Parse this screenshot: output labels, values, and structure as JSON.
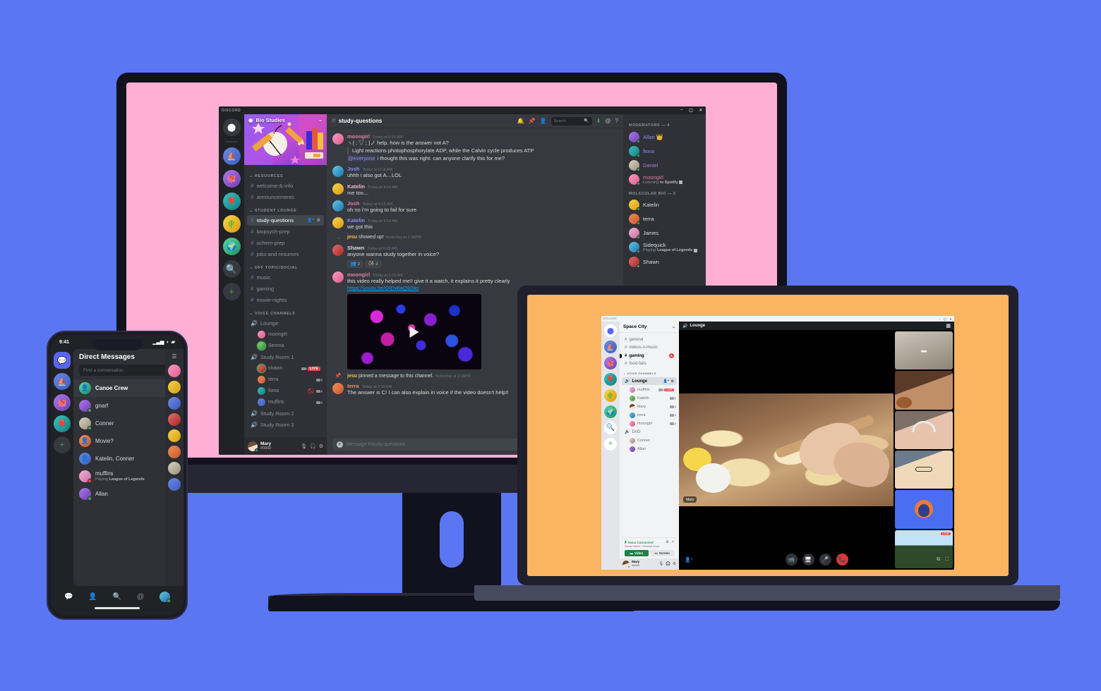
{
  "scene": {
    "background_color": "#5a76f3",
    "monitor_screen_color": "#ffaed4",
    "laptop_screen_color": "#fbb461"
  },
  "desktop": {
    "window_brand": "DISCORD",
    "window_controls": {
      "minimize": "–",
      "maximize": "▢",
      "close": "✕"
    },
    "server_name": "Bio Studies",
    "chevron": "⌄",
    "categories": [
      {
        "name": "RESOURCES",
        "channels": [
          {
            "name": "welcome-&-info",
            "selected": false
          },
          {
            "name": "announcements",
            "selected": false
          }
        ]
      },
      {
        "name": "STUDENT LOUNGE",
        "channels": [
          {
            "name": "study-questions",
            "selected": true
          },
          {
            "name": "biopsych-prep",
            "selected": false
          },
          {
            "name": "ochem-prep",
            "selected": false
          },
          {
            "name": "jobs-and-resumes",
            "selected": false
          }
        ]
      },
      {
        "name": "OFF TOPIC/SOCIAL",
        "channels": [
          {
            "name": "music",
            "selected": false
          },
          {
            "name": "gaming",
            "selected": false
          },
          {
            "name": "movie-nights",
            "selected": false
          }
        ]
      }
    ],
    "voice_category": "VOICE CHANNELS",
    "voice_channels": [
      {
        "name": "Lounge",
        "users": [
          {
            "name": "moongirl",
            "speaking": false,
            "video": false,
            "live": false,
            "muted": false,
            "avatar": "av1"
          },
          {
            "name": "Serena",
            "speaking": true,
            "video": false,
            "live": false,
            "muted": false,
            "avatar": "av9"
          }
        ]
      },
      {
        "name": "Study Room 1",
        "users": [
          {
            "name": "shawn",
            "speaking": true,
            "video": true,
            "live": true,
            "live_label": "LIVE",
            "muted": false,
            "avatar": "av8"
          },
          {
            "name": "terra",
            "speaking": false,
            "video": true,
            "live": false,
            "muted": false,
            "avatar": "av6"
          },
          {
            "name": "fiona",
            "speaking": false,
            "video": true,
            "live": false,
            "muted": true,
            "avatar": "av12"
          },
          {
            "name": "muffins",
            "speaking": false,
            "video": true,
            "live": false,
            "muted": false,
            "avatar": "av2"
          }
        ]
      },
      {
        "name": "Study Room 2",
        "users": []
      },
      {
        "name": "Study Room 3",
        "users": []
      }
    ],
    "user_panel": {
      "name": "Mary",
      "tag": "#0000",
      "mic": "🎤",
      "headphones": "🎧",
      "settings": "⚙"
    },
    "header": {
      "hash": "#",
      "channel": "study-questions",
      "icons": [
        "bell-icon",
        "pin-icon",
        "members-icon"
      ],
      "search_placeholder": "Search",
      "trailing_icons": [
        "inbox-icon",
        "mentions-icon",
        "help-icon"
      ]
    },
    "messages": [
      {
        "type": "message",
        "author": "moongirl",
        "author_color": "#e27ea6",
        "time": "Today at 9:16 AM",
        "avatar": "av1",
        "lines": [
          {
            "kind": "text",
            "text": "ヽ( ; ▽ ; )ノ help. how is the answer not A?"
          },
          {
            "kind": "quote",
            "text": "Light reactions photophosphorylate ADP, while the Calvin cycle produces ATP"
          },
          {
            "kind": "mention",
            "mention": "@everyone",
            "text": " i thought this was right. can anyone clarify this for me?"
          }
        ]
      },
      {
        "type": "message",
        "author": "Josh",
        "author_color": "#8a8ef5",
        "time": "Today at 9:18 AM",
        "avatar": "av7",
        "lines": [
          {
            "kind": "text",
            "text": "uhhh i also got A…LOL"
          }
        ]
      },
      {
        "type": "message",
        "author": "Katelin",
        "author_color": "#f2b6d5",
        "time": "Today at 9:18 AM",
        "avatar": "av3",
        "lines": [
          {
            "kind": "text",
            "text": "me too…"
          }
        ]
      },
      {
        "type": "message",
        "author": "Josh",
        "author_color": "#e27ea6",
        "time": "Today at 9:18 AM",
        "avatar": "av7",
        "lines": [
          {
            "kind": "text",
            "text": "oh no i'm going to fail for sure"
          }
        ]
      },
      {
        "type": "message",
        "author": "Katelin",
        "author_color": "#8a8ef5",
        "time": "Today at 9:18 AM",
        "avatar": "av3",
        "lines": [
          {
            "kind": "text",
            "text": "we got this"
          }
        ]
      },
      {
        "type": "system_join",
        "icon": "arrow-right-icon",
        "actor": "jesu",
        "text": " showed up!",
        "time": "Yesterday at 2:38PM"
      },
      {
        "type": "message",
        "author": "Shawn",
        "author_color": "#dcddde",
        "time": "Today at 9:18 AM",
        "avatar": "av8",
        "lines": [
          {
            "kind": "text",
            "text": "anyone wanna study together in voice?"
          }
        ],
        "reactions": [
          {
            "emoji": "👥",
            "count": "3"
          },
          {
            "emoji": "👫",
            "count": "3"
          }
        ]
      },
      {
        "type": "message",
        "author": "moongirl",
        "author_color": "#e27ea6",
        "time": "Today at 9:16 AM",
        "avatar": "av1",
        "lines": [
          {
            "kind": "text",
            "text": "this video really helped me!! give it a watch, it explains it pretty clearly"
          },
          {
            "kind": "link",
            "text": "https://youtu.be/OIDx6aQ928o"
          }
        ],
        "embed": {
          "type": "video",
          "play_icon": "play-icon"
        }
      },
      {
        "type": "system_pin",
        "icon": "pin-icon",
        "actor": "jesu",
        "text": " pinned a message to this channel.",
        "time": "Yesterday at 2:38PM"
      },
      {
        "type": "message",
        "author": "terra",
        "author_color": "#f0915a",
        "time": "Today at 9:19 AM",
        "avatar": "av6",
        "lines": [
          {
            "kind": "text",
            "text": "The answer is C! I can also explain in voice if the video doesn't help!!"
          }
        ]
      }
    ],
    "composer_placeholder": "Message #study-questions",
    "member_groups": [
      {
        "title": "MODERATORS — 4",
        "members": [
          {
            "name": "Allan",
            "color": "#8a8ef5",
            "badge": "👑",
            "avatar": "av5"
          },
          {
            "name": "fiona",
            "color": "#8a8ef5",
            "avatar": "av12"
          },
          {
            "name": "Daniel",
            "color": "#b07ae8",
            "avatar": "av10"
          },
          {
            "name": "moongirl",
            "color": "#e27ea6",
            "avatar": "av1",
            "status": "Listening to Spotify"
          }
        ]
      },
      {
        "title": "MOLECULAR BIO — 5",
        "members": [
          {
            "name": "Katelin",
            "color": "#dcddde",
            "avatar": "av3"
          },
          {
            "name": "terra",
            "color": "#dcddde",
            "avatar": "av6"
          },
          {
            "name": "James",
            "color": "#dcddde",
            "avatar": "av11"
          },
          {
            "name": "Sidequick",
            "color": "#dcddde",
            "avatar": "av7",
            "status": "Playing League of Legends"
          },
          {
            "name": "Shawn",
            "color": "#dcddde",
            "avatar": "av8"
          }
        ]
      }
    ],
    "server_rail": [
      {
        "name": "discord-home",
        "type": "home",
        "glyph": "⬤"
      },
      {
        "name": "server-sailboat",
        "avatar": "av2",
        "glyph": "⛵"
      },
      {
        "name": "server-bio-studies",
        "avatar": "av5",
        "glyph": "🐙",
        "selected": true
      },
      {
        "name": "server-teal",
        "avatar": "av12",
        "glyph": "🎈"
      },
      {
        "name": "server-cactus",
        "avatar": "av3",
        "glyph": "🌵"
      },
      {
        "name": "server-space",
        "avatar": "av4",
        "glyph": "🌍"
      },
      {
        "name": "explore-servers",
        "type": "action",
        "glyph": "🔍"
      },
      {
        "name": "add-server",
        "type": "action",
        "glyph": "+"
      }
    ]
  },
  "laptop": {
    "window_brand": "DISCORD",
    "server_name": "Space City",
    "chevron": "⌄",
    "channels": [
      {
        "name": "general",
        "state": "read"
      },
      {
        "name": "videos-n-music",
        "state": "read"
      },
      {
        "name": "gaming",
        "state": "unread",
        "badge": "1"
      },
      {
        "name": "food-fails",
        "state": "read"
      }
    ],
    "voice_category": "VOICE CHANNELS",
    "voice_channels": [
      {
        "name": "Lounge",
        "selected": true,
        "users": [
          {
            "name": "muffins",
            "live": true,
            "live_label": "LIVE",
            "video": true,
            "avatar": "av11"
          },
          {
            "name": "Katelin",
            "video": true,
            "avatar": "av9"
          },
          {
            "name": "Mary",
            "video": true,
            "avatar": "ph-face"
          },
          {
            "name": "kova",
            "video": true,
            "avatar": "av7"
          },
          {
            "name": "moongirl",
            "video": true,
            "avatar": "av1"
          }
        ]
      },
      {
        "name": "DnD",
        "selected": false,
        "users": [
          {
            "name": "Conner",
            "avatar": "av10"
          },
          {
            "name": "Allan",
            "avatar": "av5"
          }
        ]
      }
    ],
    "voice_status": {
      "title": "Voice Connected",
      "subtitle": "Server Name / General Voice",
      "video_button": "Video",
      "screen_button": "Screen",
      "icons": [
        "signal-icon",
        "settings-icon",
        "disconnect-icon"
      ]
    },
    "user_panel": {
      "name": "Mary",
      "tag": "#0000",
      "mic": "🎤",
      "headphones": "🎧",
      "settings": "⚙"
    },
    "call": {
      "channel_name": "Lounge",
      "speaker_icon": "speaker-icon",
      "grid_icon": "grid-icon",
      "main_tile_name": "Mary",
      "tiles": [
        {
          "name": "tile-camera-off",
          "style": "t1",
          "camera_off": true
        },
        {
          "name": "tile-guitar",
          "style": "t2"
        },
        {
          "name": "tile-headphones",
          "style": "t3"
        },
        {
          "name": "tile-glasses",
          "style": "t4"
        },
        {
          "name": "tile-avatar",
          "style": "t5"
        },
        {
          "name": "tile-game-stream",
          "style": "t6",
          "live": true,
          "live_label": "LIVE"
        }
      ],
      "controls": [
        {
          "name": "camera-button",
          "glyph": "📹"
        },
        {
          "name": "screenshare-button",
          "glyph": "🖥"
        },
        {
          "name": "mute-button",
          "glyph": "🎤"
        },
        {
          "name": "hangup-button",
          "glyph": "📞",
          "danger": true
        }
      ],
      "left_icon": "invite-icon",
      "right_icons": [
        "popout-icon",
        "fullscreen-icon"
      ]
    }
  },
  "phone": {
    "status": {
      "time": "9:41",
      "signal": "signal-icon",
      "wifi": "wifi-icon",
      "battery": "battery-icon"
    },
    "title": "Direct Messages",
    "new_dm_icon": "new-message-icon",
    "menu_icon": "hamburger-icon",
    "search_placeholder": "Find a conversation",
    "dms": [
      {
        "name": "Canoe Crew",
        "type": "group",
        "avatar": "av4",
        "glyph": "👤",
        "selected": true
      },
      {
        "name": "gnarf",
        "avatar": "av5",
        "status": "online"
      },
      {
        "name": "Conner",
        "avatar": "av10",
        "status": "online"
      },
      {
        "name": "Movie?",
        "type": "group",
        "avatar": "av6",
        "glyph": "👤"
      },
      {
        "name": "Katelin, Conner",
        "type": "group",
        "avatar": "av2",
        "glyph": "👤"
      },
      {
        "name": "muffins",
        "avatar": "av11",
        "status": "dnd",
        "sub_prefix": "Playing ",
        "sub_bold": "League of Legends"
      },
      {
        "name": "Allan",
        "avatar": "av5",
        "status": "online"
      }
    ],
    "rail": [
      {
        "name": "home-dms",
        "type": "home",
        "glyph": "💬",
        "selected": true
      },
      {
        "name": "server-sailboat",
        "avatar": "av2",
        "glyph": "⛵"
      },
      {
        "name": "server-octopus",
        "avatar": "av5",
        "glyph": "🐙"
      },
      {
        "name": "server-teal",
        "avatar": "av12",
        "glyph": "🎈"
      },
      {
        "name": "add-server",
        "type": "action",
        "glyph": "+"
      }
    ],
    "nav": [
      {
        "name": "nav-home",
        "glyph": "💬",
        "active": true
      },
      {
        "name": "nav-friends",
        "glyph": "👤"
      },
      {
        "name": "nav-search",
        "glyph": "🔍"
      },
      {
        "name": "nav-mentions",
        "glyph": "@"
      },
      {
        "name": "nav-profile",
        "glyph": "",
        "avatar": true
      }
    ]
  }
}
